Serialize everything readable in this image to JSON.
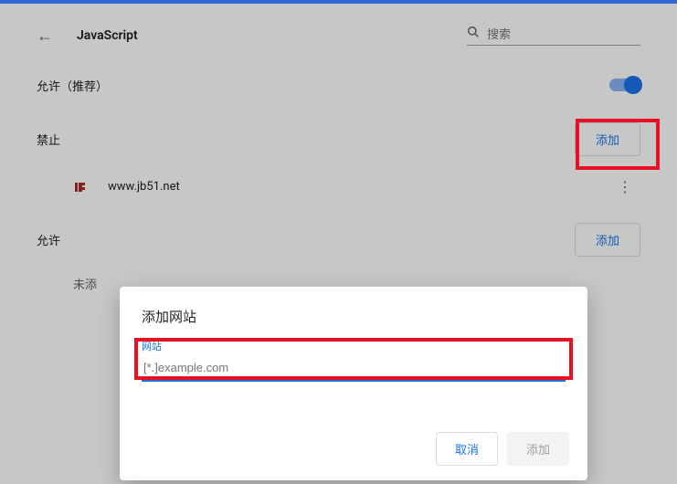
{
  "header": {
    "title": "JavaScript",
    "search_placeholder": "搜索"
  },
  "settings": {
    "allow_recommended_label": "允许（推荐）",
    "toggle_on": true
  },
  "blocked": {
    "title": "禁止",
    "add_label": "添加",
    "sites": [
      {
        "url": "www.jb51.net"
      }
    ]
  },
  "allowed": {
    "title": "允许",
    "add_label": "添加",
    "empty_prefix": "未添"
  },
  "dialog": {
    "title": "添加网站",
    "field_label": "网站",
    "placeholder": "[*.]example.com",
    "value": "",
    "cancel_label": "取消",
    "confirm_label": "添加"
  }
}
